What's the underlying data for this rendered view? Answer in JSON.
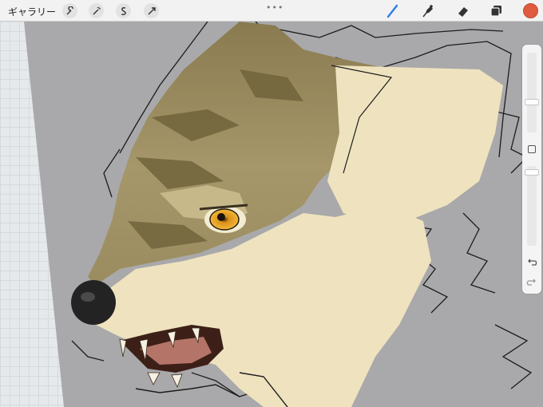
{
  "toolbar": {
    "gallery_label": "ギャラリー",
    "left_tools": [
      "wrench-icon",
      "magic-wand-icon",
      "selection-icon",
      "transform-icon"
    ],
    "center_handle": "•••",
    "right_tools": [
      "brush-icon",
      "smudge-icon",
      "eraser-icon",
      "layers-icon"
    ],
    "active_tool": "brush-icon",
    "current_color": "#df5a3e"
  },
  "sidebar": {
    "brush_size_level": 0.45,
    "opacity_level": 0.85,
    "controls": [
      "brush-size-slider",
      "modify-button",
      "opacity-slider",
      "undo-icon",
      "redo-icon"
    ]
  },
  "canvas": {
    "background_color": "#a9a9ab",
    "subject": "wolf-head-painting"
  }
}
